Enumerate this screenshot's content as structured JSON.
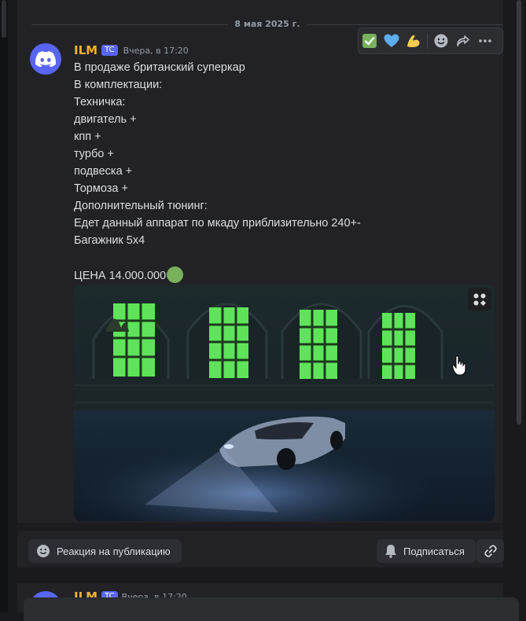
{
  "date_divider": "8 мая 2025 г.",
  "message": {
    "author": "ILM",
    "author_color": "#f0b232",
    "tag": "TC",
    "timestamp": "Вчера, в 17:20",
    "lines": [
      "В продаже британский суперкар",
      "В комплектации:",
      "Техничка:",
      "двигатель +",
      "кпп +",
      "турбо +",
      "подвеска +",
      "Тормоза +",
      "Дополнительный тюнинг:",
      "Едет данный аппарат по мкаду приблизительно 240+-",
      "Багажник 5x4",
      "",
      "ЦЕНА 14.000.000"
    ],
    "price_emoji": "green-circle-icon",
    "image_alt": "car-photo"
  },
  "hover_actions": [
    {
      "icon": "white-check-mark-emoji",
      "glyph": "✅"
    },
    {
      "icon": "blue-heart-emoji",
      "glyph": "💙"
    },
    {
      "icon": "flexed-biceps-emoji",
      "glyph": "💪"
    },
    {
      "icon": "add-reaction-icon"
    },
    {
      "icon": "forward-icon"
    },
    {
      "icon": "more-icon"
    }
  ],
  "footer": {
    "react_label": "Реакция на публикацию",
    "subscribe_label": "Подписаться"
  },
  "next_message": {
    "author": "ILM",
    "tag": "TC",
    "timestamp": "Вчера, в 17:20"
  },
  "colors": {
    "accent": "#5865f2",
    "background": "#222226",
    "text": "#dbdee1",
    "muted": "#949ba4"
  }
}
